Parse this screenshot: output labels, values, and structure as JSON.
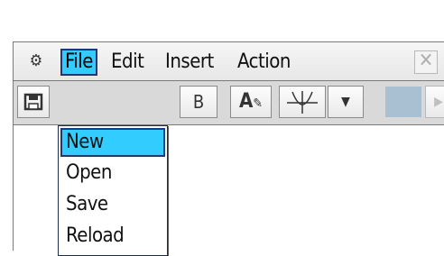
{
  "menubar": {
    "gear_icon": "gear-icon",
    "items": [
      {
        "label": "File",
        "active": true
      },
      {
        "label": "Edit"
      },
      {
        "label": "Insert"
      },
      {
        "label": "Action"
      }
    ],
    "close_icon": "close-icon"
  },
  "toolbar": {
    "save_icon": "floppy-disk-icon",
    "bold_label": "B",
    "text_style_label": "A",
    "graph_icon": "graph-icon",
    "dropdown_icon": "triangle-down-icon",
    "next_icon": "triangle-right-icon"
  },
  "file_menu": {
    "items": [
      {
        "label": "New",
        "selected": true
      },
      {
        "label": "Open"
      },
      {
        "label": "Save"
      },
      {
        "label": "Reload"
      }
    ]
  },
  "colors": {
    "highlight": "#33ccff",
    "highlight_border": "#1a3b75",
    "toolbar_bg": "#d9d9d9",
    "accent_block": "#a9bfd2"
  }
}
